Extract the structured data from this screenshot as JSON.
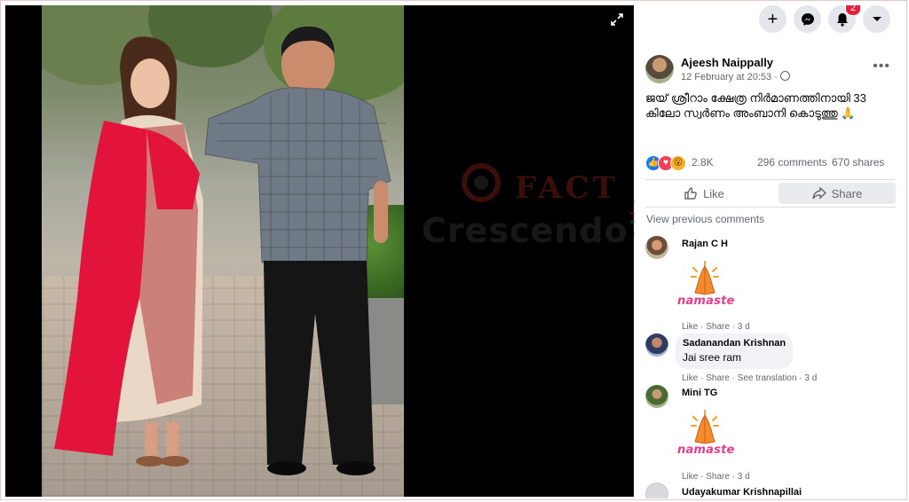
{
  "viewer": {
    "expand_icon": "expand-icon"
  },
  "watermark": {
    "line1": "FACT",
    "line2": "Crescendo"
  },
  "topbar": {
    "create_icon": "plus-icon",
    "messenger_icon": "messenger-icon",
    "notifications_icon": "bell-icon",
    "notifications_count": "2",
    "account_icon": "caret-down-icon"
  },
  "post": {
    "author": "Ajeesh Naippally",
    "time": "12 February at 20:53 · ",
    "audience_icon": "globe-icon",
    "text": "ജയ് ശ്രീറാം ക്ഷേത്ര നിർമാണത്തിനായി 33 കിലോ സ്വർണം അംബാനി കൊടുത്തു 🙏",
    "reactions_count": "2.8K",
    "comments_count": "296 comments",
    "shares_count": "670 shares",
    "like_label": "Like",
    "share_label": "Share",
    "view_previous": "View previous comments"
  },
  "comments": [
    {
      "name": "Rajan C H",
      "sticker": "namaste",
      "actions": "Like · Share · 3 d"
    },
    {
      "name": "Sadanandan Krishnan",
      "text": "Jai sree ram",
      "actions": "Like · Share · See translation · 3 d"
    },
    {
      "name": "Mini TG",
      "sticker": "namaste",
      "actions": "Like · Share · 3 d"
    },
    {
      "name": "Udayakumar Krishnapillai"
    }
  ],
  "sticker_text": "namaste",
  "colors": {
    "accent": "#1877f2",
    "badge": "#e41e3f",
    "sticker_pink": "#e83d8a",
    "sticker_orange": "#f58b2a"
  }
}
